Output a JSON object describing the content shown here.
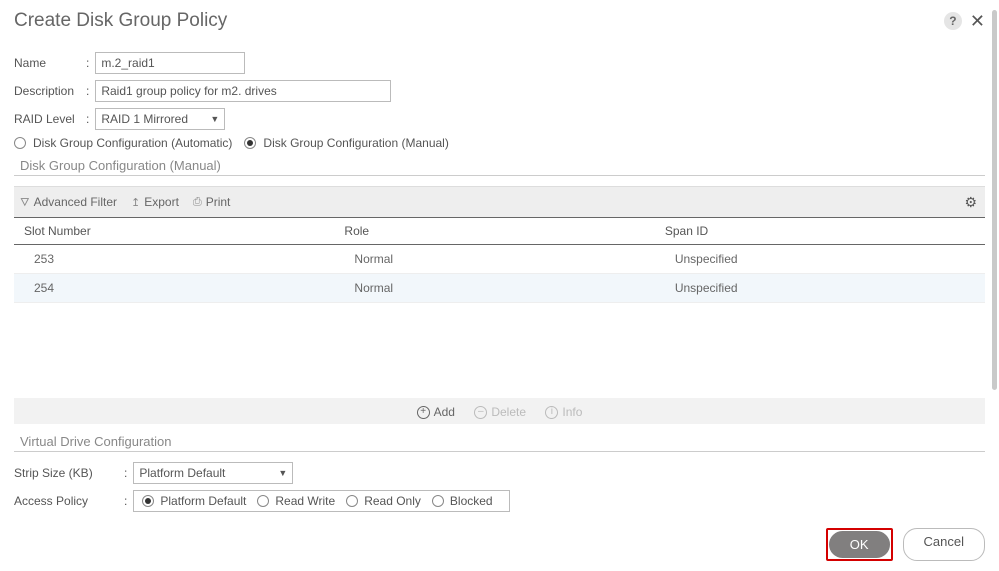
{
  "dialog": {
    "title": "Create Disk Group Policy"
  },
  "form": {
    "name_label": "Name",
    "name_value": "m.2_raid1",
    "desc_label": "Description",
    "desc_value": "Raid1 group policy for m2. drives",
    "raid_label": "RAID Level",
    "raid_value": "RAID 1 Mirrored"
  },
  "config_mode": {
    "auto": "Disk Group Configuration (Automatic)",
    "manual": "Disk Group Configuration (Manual)",
    "selected": "manual"
  },
  "manual_section": {
    "title": "Disk Group Configuration (Manual)",
    "toolbar": {
      "filter": "Advanced Filter",
      "export": "Export",
      "print": "Print"
    },
    "columns": {
      "slot": "Slot Number",
      "role": "Role",
      "span": "Span ID"
    },
    "rows": [
      {
        "slot": "253",
        "role": "Normal",
        "span": "Unspecified"
      },
      {
        "slot": "254",
        "role": "Normal",
        "span": "Unspecified"
      }
    ],
    "actions": {
      "add": "Add",
      "delete": "Delete",
      "info": "Info"
    }
  },
  "virtual": {
    "title": "Virtual Drive Configuration",
    "strip_label": "Strip Size (KB)",
    "strip_value": "Platform Default",
    "access_label": "Access Policy",
    "access_options": {
      "platform": "Platform Default",
      "rw": "Read Write",
      "ro": "Read Only",
      "blocked": "Blocked"
    },
    "access_selected": "platform"
  },
  "footer": {
    "ok": "OK",
    "cancel": "Cancel"
  }
}
